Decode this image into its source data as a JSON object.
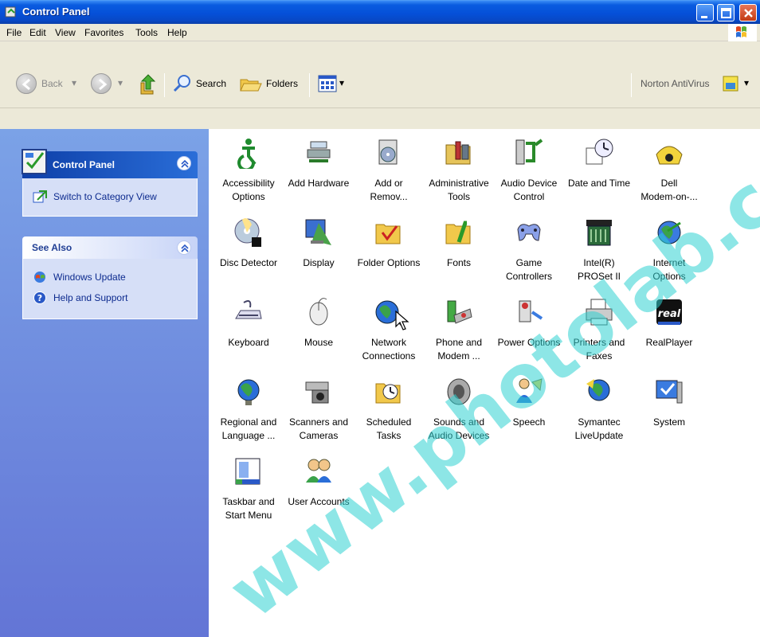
{
  "window": {
    "title": "Control Panel"
  },
  "menu": [
    "File",
    "Edit",
    "View",
    "Favorites",
    "Tools",
    "Help"
  ],
  "toolbar": {
    "back_label": "Back",
    "search_label": "Search",
    "folders_label": "Folders",
    "norton_label": "Norton AntiVirus"
  },
  "left_pane": {
    "control_panel_title": "Control Panel",
    "switch_view_label": "Switch to Category View",
    "see_also_title": "See Also",
    "see_also_links": [
      "Windows Update",
      "Help and Support"
    ]
  },
  "items": [
    {
      "label": "Accessibility\nOptions",
      "icon": "accessibility-icon"
    },
    {
      "label": "Add Hardware",
      "icon": "add-hardware-icon"
    },
    {
      "label": "Add or\nRemov...",
      "icon": "add-remove-programs-icon"
    },
    {
      "label": "Administrative\nTools",
      "icon": "administrative-tools-icon"
    },
    {
      "label": "Audio Device\nControl",
      "icon": "audio-device-icon"
    },
    {
      "label": "Date and Time",
      "icon": "date-time-icon"
    },
    {
      "label": "Dell\nModem-on-...",
      "icon": "modem-phone-icon"
    },
    {
      "label": "Disc Detector",
      "icon": "disc-detector-icon"
    },
    {
      "label": "Display",
      "icon": "display-icon"
    },
    {
      "label": "Folder Options",
      "icon": "folder-options-icon"
    },
    {
      "label": "Fonts",
      "icon": "fonts-folder-icon"
    },
    {
      "label": "Game\nControllers",
      "icon": "game-controller-icon"
    },
    {
      "label": "Intel(R)\nPROSet II",
      "icon": "intel-proset-icon"
    },
    {
      "label": "Internet\nOptions",
      "icon": "internet-options-icon"
    },
    {
      "label": "Keyboard",
      "icon": "keyboard-icon"
    },
    {
      "label": "Mouse",
      "icon": "mouse-icon"
    },
    {
      "label": "Network\nConnections",
      "icon": "network-connections-icon"
    },
    {
      "label": "Phone and\nModem ...",
      "icon": "phone-modem-icon"
    },
    {
      "label": "Power Options",
      "icon": "power-options-icon"
    },
    {
      "label": "Printers and\nFaxes",
      "icon": "printer-icon"
    },
    {
      "label": "RealPlayer",
      "icon": "realplayer-icon"
    },
    {
      "label": "Regional and\nLanguage ...",
      "icon": "regional-globe-icon"
    },
    {
      "label": "Scanners and\nCameras",
      "icon": "scanner-camera-icon"
    },
    {
      "label": "Scheduled\nTasks",
      "icon": "scheduled-tasks-icon"
    },
    {
      "label": "Sounds and\nAudio Devices",
      "icon": "speaker-icon"
    },
    {
      "label": "Speech",
      "icon": "speech-icon"
    },
    {
      "label": "Symantec\nLiveUpdate",
      "icon": "live-update-icon"
    },
    {
      "label": "System",
      "icon": "system-icon"
    },
    {
      "label": "Taskbar and\nStart Menu",
      "icon": "taskbar-icon"
    },
    {
      "label": "User Accounts",
      "icon": "user-accounts-icon"
    }
  ],
  "watermark_text": "www.photolab.com.ua"
}
